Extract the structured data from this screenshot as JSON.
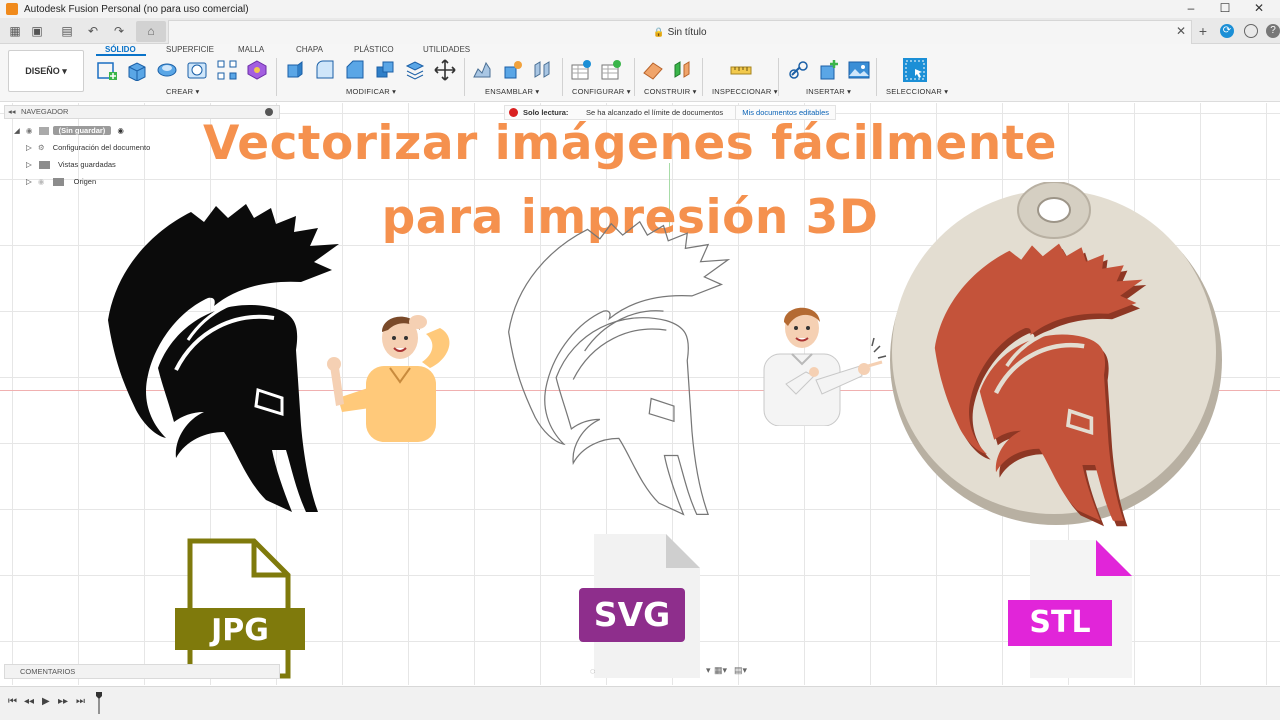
{
  "window": {
    "title": "Autodesk Fusion Personal (no para uso comercial)"
  },
  "tab": {
    "title": "Sin título"
  },
  "toolbar": {
    "workspace": "DISEÑO",
    "ribbon_tabs": [
      "SÓLIDO",
      "SUPERFICIE",
      "MALLA",
      "CHAPA",
      "PLÁSTICO",
      "UTILIDADES"
    ],
    "groups": [
      "CREAR",
      "MODIFICAR",
      "ENSAMBLAR",
      "CONFIGURAR",
      "CONSTRUIR",
      "INSPECCIONAR",
      "INSERTAR",
      "SELECCIONAR"
    ]
  },
  "navigator": {
    "header": "NAVEGADOR",
    "root": "(Sin guardar)",
    "items": [
      "Configuración del documento",
      "Vistas guardadas",
      "Origen"
    ]
  },
  "banner": {
    "label": "Solo lectura:",
    "message": "Se ha alcanzado el límite de documentos",
    "link": "Mis documentos editables"
  },
  "headline": {
    "line1": "Vectorizar imágenes fácilmente",
    "line2": "para impresión 3D"
  },
  "badges": {
    "jpg": "JPG",
    "svg": "SVG",
    "stl": "STL"
  },
  "colors": {
    "headline": "#f5914e",
    "jpg": "#7f7a0c",
    "svg": "#8e2e8c",
    "stl": "#e125d9",
    "accent": "#0a73c9",
    "keychain": "#c4533a"
  },
  "comments": {
    "label": "COMENTARIOS"
  }
}
